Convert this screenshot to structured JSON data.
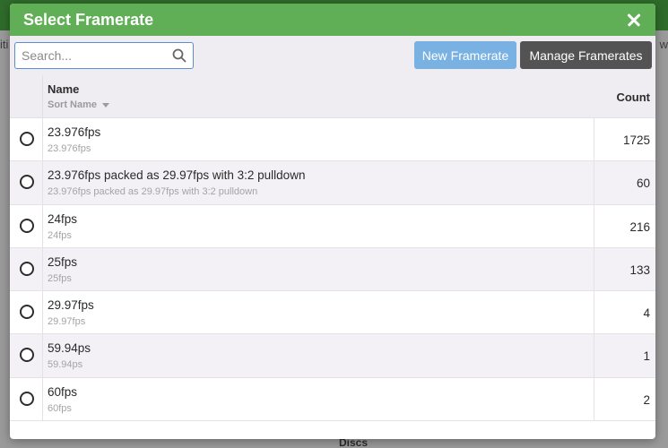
{
  "background": {
    "left_fragment": "iti",
    "right_fragment": "w",
    "footer_label": "Discs"
  },
  "modal": {
    "title": "Select Framerate",
    "close_icon": "close-icon"
  },
  "toolbar": {
    "search_placeholder": "Search...",
    "search_icon": "search-icon",
    "new_button": "New Framerate",
    "manage_button": "Manage Framerates"
  },
  "table": {
    "header": {
      "name": "Name",
      "sort_name": "Sort Name",
      "count": "Count"
    },
    "rows": [
      {
        "name": "23.976fps",
        "sort_name": "23.976fps",
        "count": "1725"
      },
      {
        "name": "23.976fps packed as 29.97fps with 3:2 pulldown",
        "sort_name": "23.976fps packed as 29.97fps with 3:2 pulldown",
        "count": "60"
      },
      {
        "name": "24fps",
        "sort_name": "24fps",
        "count": "216"
      },
      {
        "name": "25fps",
        "sort_name": "25fps",
        "count": "133"
      },
      {
        "name": "29.97fps",
        "sort_name": "29.97fps",
        "count": "4"
      },
      {
        "name": "59.94ps",
        "sort_name": "59.94ps",
        "count": "1"
      },
      {
        "name": "60fps",
        "sort_name": "60fps",
        "count": "2"
      }
    ]
  },
  "colors": {
    "header_green": "#60ae55",
    "new_button_blue": "#7ab1e3",
    "manage_button_gray": "#535353",
    "search_border": "#5b8fd0"
  }
}
